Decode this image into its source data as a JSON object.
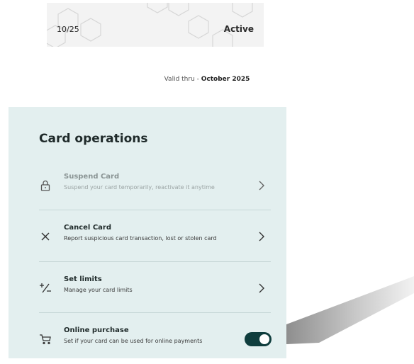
{
  "card": {
    "expiry_short": "10/25",
    "status": "Active",
    "valid_thru_label": "Valid thru - ",
    "valid_thru_value": "October 2025"
  },
  "card_operations": {
    "title": "Card operations",
    "items": [
      {
        "title": "Suspend Card",
        "description": "Suspend your card temporarily, reactivate it anytime",
        "icon": "lock-icon",
        "state": "disabled"
      },
      {
        "title": "Cancel Card",
        "description": "Report suspicious card transaction, lost or stolen card",
        "icon": "close-icon"
      },
      {
        "title": "Set limits",
        "description": "Manage your card limits",
        "icon": "plus-minus-icon"
      },
      {
        "title": "Online purchase",
        "description": "Set if your card can be used for online payments",
        "icon": "cart-icon",
        "toggle_on": true
      }
    ]
  },
  "colors": {
    "panel_bg": "#e3efef",
    "toggle_on": "#0f3d3d"
  }
}
